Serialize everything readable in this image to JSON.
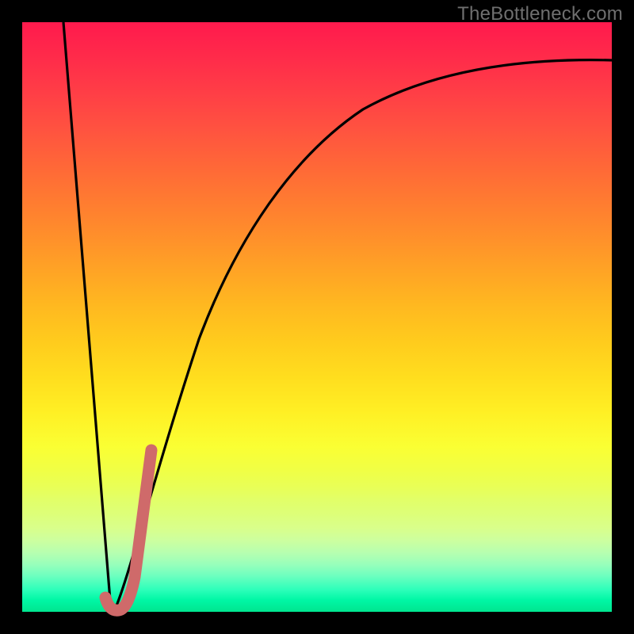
{
  "watermark": "TheBottleneck.com",
  "chart_data": {
    "type": "line",
    "title": "",
    "xlabel": "",
    "ylabel": "",
    "xlim": [
      0,
      100
    ],
    "ylim": [
      0,
      100
    ],
    "series": [
      {
        "name": "main-curve",
        "x": [
          7,
          15,
          20,
          25,
          30,
          35,
          40,
          45,
          50,
          55,
          60,
          65,
          70,
          75,
          80,
          85,
          90,
          95,
          100
        ],
        "values": [
          100,
          0,
          22,
          40,
          54,
          64,
          72,
          78,
          82,
          85,
          87.5,
          89.2,
          90.5,
          91.5,
          92.2,
          92.7,
          93.1,
          93.4,
          93.6
        ]
      },
      {
        "name": "highlight-segment",
        "x": [
          14,
          15,
          16,
          17,
          18,
          19,
          20,
          21
        ],
        "values": [
          2,
          0,
          0.3,
          4,
          10,
          17,
          23,
          28
        ]
      }
    ],
    "colors": {
      "main_curve": "#000000",
      "highlight": "#cf6a6a",
      "gradient_top": "#ff1a4d",
      "gradient_bottom": "#00e58f"
    }
  }
}
